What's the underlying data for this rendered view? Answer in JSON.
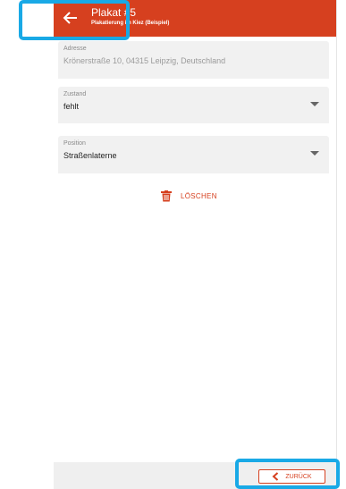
{
  "appbar": {
    "title": "Plakat #5",
    "subtitle": "Plakatierung im Kiez (Beispiel)",
    "back_icon": "arrow-left-icon"
  },
  "fields": {
    "address": {
      "label": "Adresse",
      "value": "Krönerstraße 10, 04315 Leipzig, Deutschland"
    },
    "state": {
      "label": "Zustand",
      "value": "fehlt"
    },
    "position": {
      "label": "Position",
      "value": "Straßenlaterne"
    }
  },
  "delete": {
    "label": "LÖSCHEN",
    "icon": "trash-icon"
  },
  "footer": {
    "back_label": "ZURÜCK",
    "back_icon": "chevron-left-icon"
  },
  "colors": {
    "accent": "#d6401f",
    "highlight": "#19a9e6",
    "field_bg": "#f1f1f1",
    "footer_bg": "#efefef"
  }
}
